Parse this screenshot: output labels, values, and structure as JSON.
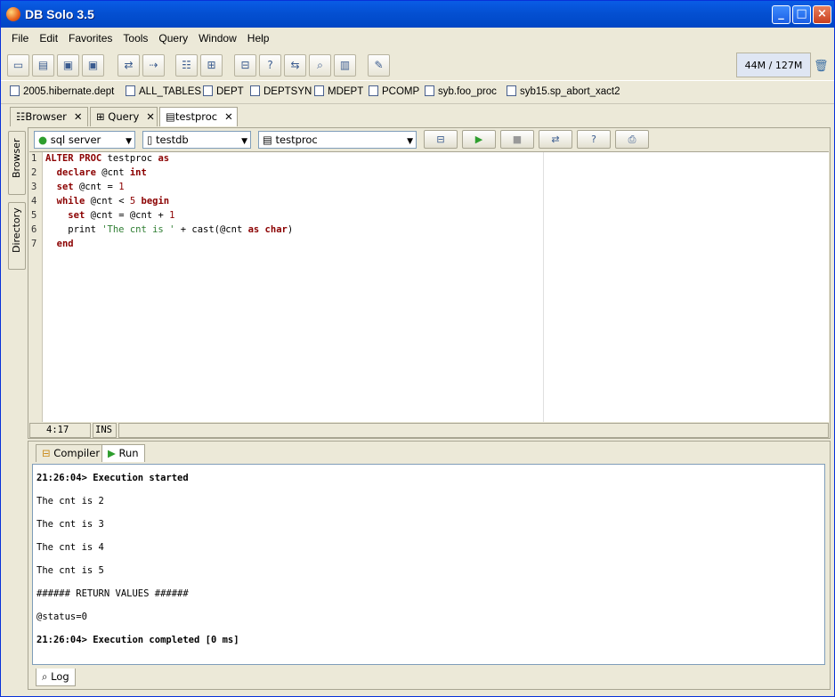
{
  "window": {
    "title": "DB Solo  3.5"
  },
  "menu": [
    "File",
    "Edit",
    "Favorites",
    "Tools",
    "Query",
    "Window",
    "Help"
  ],
  "memory": "44M / 127M",
  "favorites": [
    "2005.hibernate.dept",
    "ALL_TABLES",
    "DEPT",
    "DEPTSYN",
    "MDEPT",
    "PCOMP",
    "syb.foo_proc",
    "syb15.sp_abort_xact2"
  ],
  "tabs": [
    "Browser",
    "Query",
    "testproc"
  ],
  "sidebar": [
    "Browser",
    "Directory"
  ],
  "editor": {
    "connection": "sql server",
    "database": "testdb",
    "object": "testproc",
    "cursor": "4:17",
    "mode": "INS",
    "line_numbers": [
      "1",
      "2",
      "3",
      "4",
      "5",
      "6",
      "7"
    ]
  },
  "output": {
    "tabs": [
      "Compiler",
      "Run"
    ],
    "lines": [
      "21:26:04> Execution started",
      "The cnt is 2",
      "The cnt is 3",
      "The cnt is 4",
      "The cnt is 5",
      "###### RETURN VALUES ######",
      "@status=0",
      "21:26:04> Execution completed [0 ms]"
    ],
    "bottom_tab": "Log"
  }
}
